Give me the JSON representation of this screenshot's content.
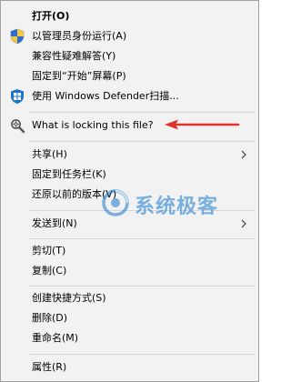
{
  "menu": {
    "items": [
      {
        "label": "打开(O)"
      },
      {
        "label": "以管理员身份运行(A)",
        "icon": "uac-shield-icon"
      },
      {
        "label": "兼容性疑难解答(Y)"
      },
      {
        "label": "固定到“开始”屏幕(P)"
      },
      {
        "label": "使用 Windows Defender扫描...",
        "icon": "windows-defender-icon"
      },
      {
        "label": "What is locking this file?",
        "icon": "magnifier-gear-icon"
      },
      {
        "label": "共享(H)"
      },
      {
        "label": "固定到任务栏(K)"
      },
      {
        "label": "还原以前的版本(V)"
      },
      {
        "label": "发送到(N)"
      },
      {
        "label": "剪切(T)"
      },
      {
        "label": "复制(C)"
      },
      {
        "label": "创建快捷方式(S)"
      },
      {
        "label": "删除(D)"
      },
      {
        "label": "重命名(M)"
      },
      {
        "label": "属性(R)"
      }
    ]
  },
  "annotation": {
    "color": "#e0302a",
    "icon": "red-arrow-pointer"
  },
  "watermark": {
    "text": "系统极客",
    "icon": "watermark-logo-icon",
    "color": "#1678cd"
  }
}
